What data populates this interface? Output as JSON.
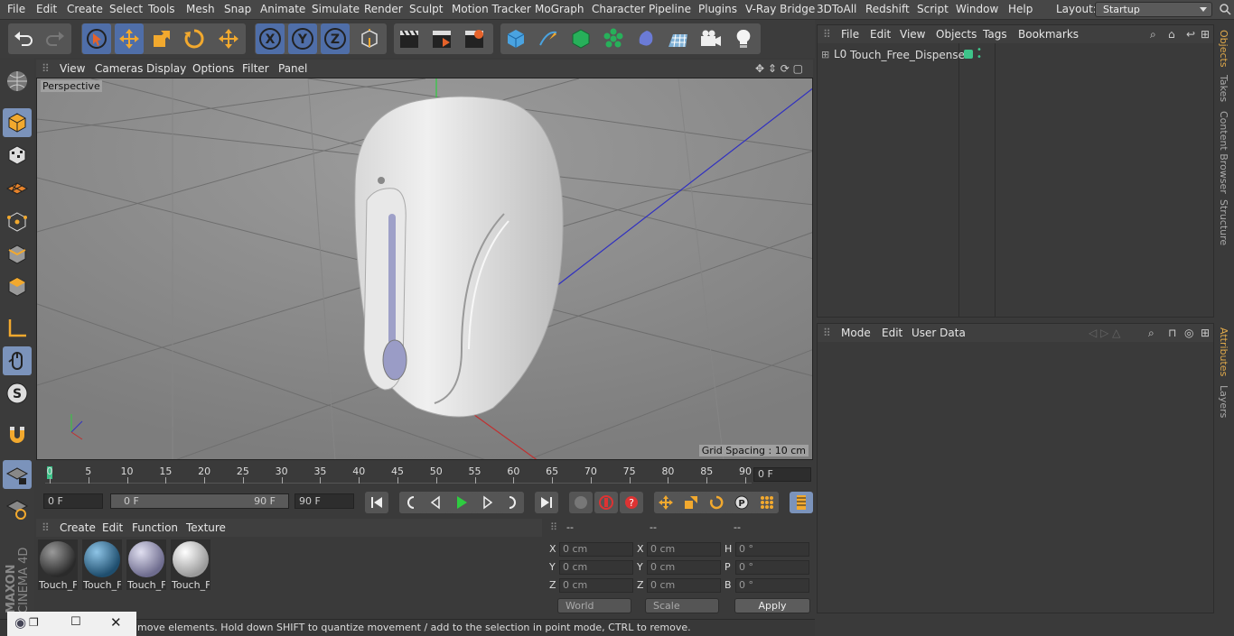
{
  "menubar": {
    "items": [
      "File",
      "Edit",
      "Create",
      "Select",
      "Tools",
      "Mesh",
      "Snap",
      "Animate",
      "Simulate",
      "Render",
      "Sculpt",
      "Motion Tracker",
      "MoGraph",
      "Character",
      "Pipeline",
      "Plugins",
      "V-Ray Bridge",
      "3DToAll",
      "Redshift",
      "Script",
      "Window",
      "Help"
    ],
    "layout_label": "Layout:",
    "layout_value": "Startup"
  },
  "toolbar": {
    "tools": [
      "undo-icon",
      "redo-icon",
      "select-icon",
      "move-icon",
      "scale-icon",
      "rotate-icon",
      "move-alt-icon",
      "x-axis-icon",
      "y-axis-icon",
      "z-axis-icon",
      "coordinate-system-icon",
      "render-view-icon",
      "render-picture-viewer-icon",
      "render-settings-icon",
      "cube-icon",
      "pen-icon",
      "subdivision-icon",
      "cloner-icon",
      "deformer-icon",
      "floor-icon",
      "camera-icon",
      "light-icon"
    ]
  },
  "viewport": {
    "menu": [
      "View",
      "Cameras",
      "Display",
      "Options",
      "Filter",
      "Panel"
    ],
    "label": "Perspective",
    "grid_spacing": "Grid Spacing : 10 cm"
  },
  "timeline": {
    "ticks": [
      "0",
      "5",
      "10",
      "15",
      "20",
      "25",
      "30",
      "35",
      "40",
      "45",
      "50",
      "55",
      "60",
      "65",
      "70",
      "75",
      "80",
      "85",
      "90"
    ],
    "current_frame": "0 F",
    "start_frame": "0 F",
    "range_start": "0 F",
    "range_end": "90 F",
    "end_frame": "90 F"
  },
  "materials": {
    "menu": [
      "Create",
      "Edit",
      "Function",
      "Texture"
    ],
    "items": [
      {
        "name": "Touch_F",
        "color": "#3a3a3a"
      },
      {
        "name": "Touch_F",
        "color": "#2e5f80"
      },
      {
        "name": "Touch_F",
        "color": "#8a88a8"
      },
      {
        "name": "Touch_F",
        "color": "#cfcfcf"
      }
    ]
  },
  "coords": {
    "headers": [
      "--",
      "--",
      "--"
    ],
    "rows": [
      {
        "a": "X",
        "av": "0 cm",
        "b": "X",
        "bv": "0 cm",
        "c": "H",
        "cv": "0 °"
      },
      {
        "a": "Y",
        "av": "0 cm",
        "b": "Y",
        "bv": "0 cm",
        "c": "P",
        "cv": "0 °"
      },
      {
        "a": "Z",
        "av": "0 cm",
        "b": "Z",
        "bv": "0 cm",
        "c": "B",
        "cv": "0 °"
      }
    ],
    "world": "World",
    "scale": "Scale",
    "apply": "Apply"
  },
  "status": "move elements. Hold down SHIFT to quantize movement / add to the selection in point mode, CTRL to remove.",
  "brand": {
    "maxon": "MAXON",
    "product": "CINEMA 4D"
  },
  "objects": {
    "menu": [
      "File",
      "Edit",
      "View",
      "Objects",
      "Tags",
      "Bookmarks"
    ],
    "items": [
      {
        "name": "Touch_Free_Dispenser"
      }
    ]
  },
  "attributes": {
    "menu": [
      "Mode",
      "Edit",
      "User Data"
    ]
  },
  "right_tabs": [
    "Objects",
    "Takes",
    "Content Browser",
    "Structure",
    "Attributes",
    "Layers"
  ],
  "colors": {
    "accent": "#4f6ea8",
    "tag_green": "#3ec48a",
    "active_tab": "#e0a94b"
  }
}
